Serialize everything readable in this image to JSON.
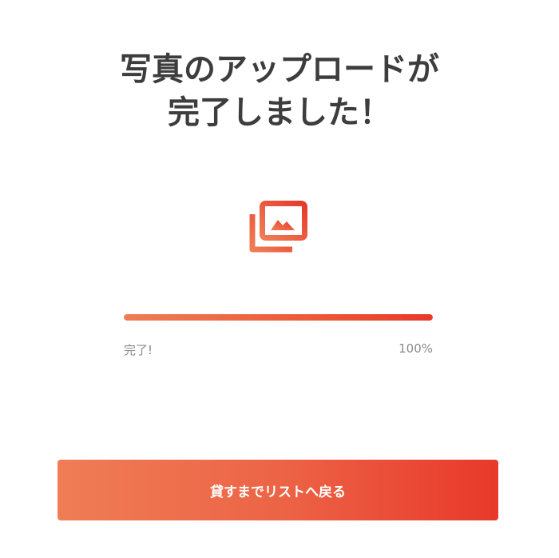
{
  "page": {
    "title_line1": "写真のアップロードが",
    "title_line2": "完了しました！"
  },
  "upload_icon": "photo-library-icon",
  "progress": {
    "label": "完了!",
    "percent_text": "100%",
    "value": 1.0
  },
  "actions": {
    "back_label": "貸すまでリストへ戻る"
  },
  "colors": {
    "accent_start": "#ef7d55",
    "accent_end": "#e8392a",
    "title_text": "#3d3d3d",
    "muted_text": "#8a8a8a"
  }
}
